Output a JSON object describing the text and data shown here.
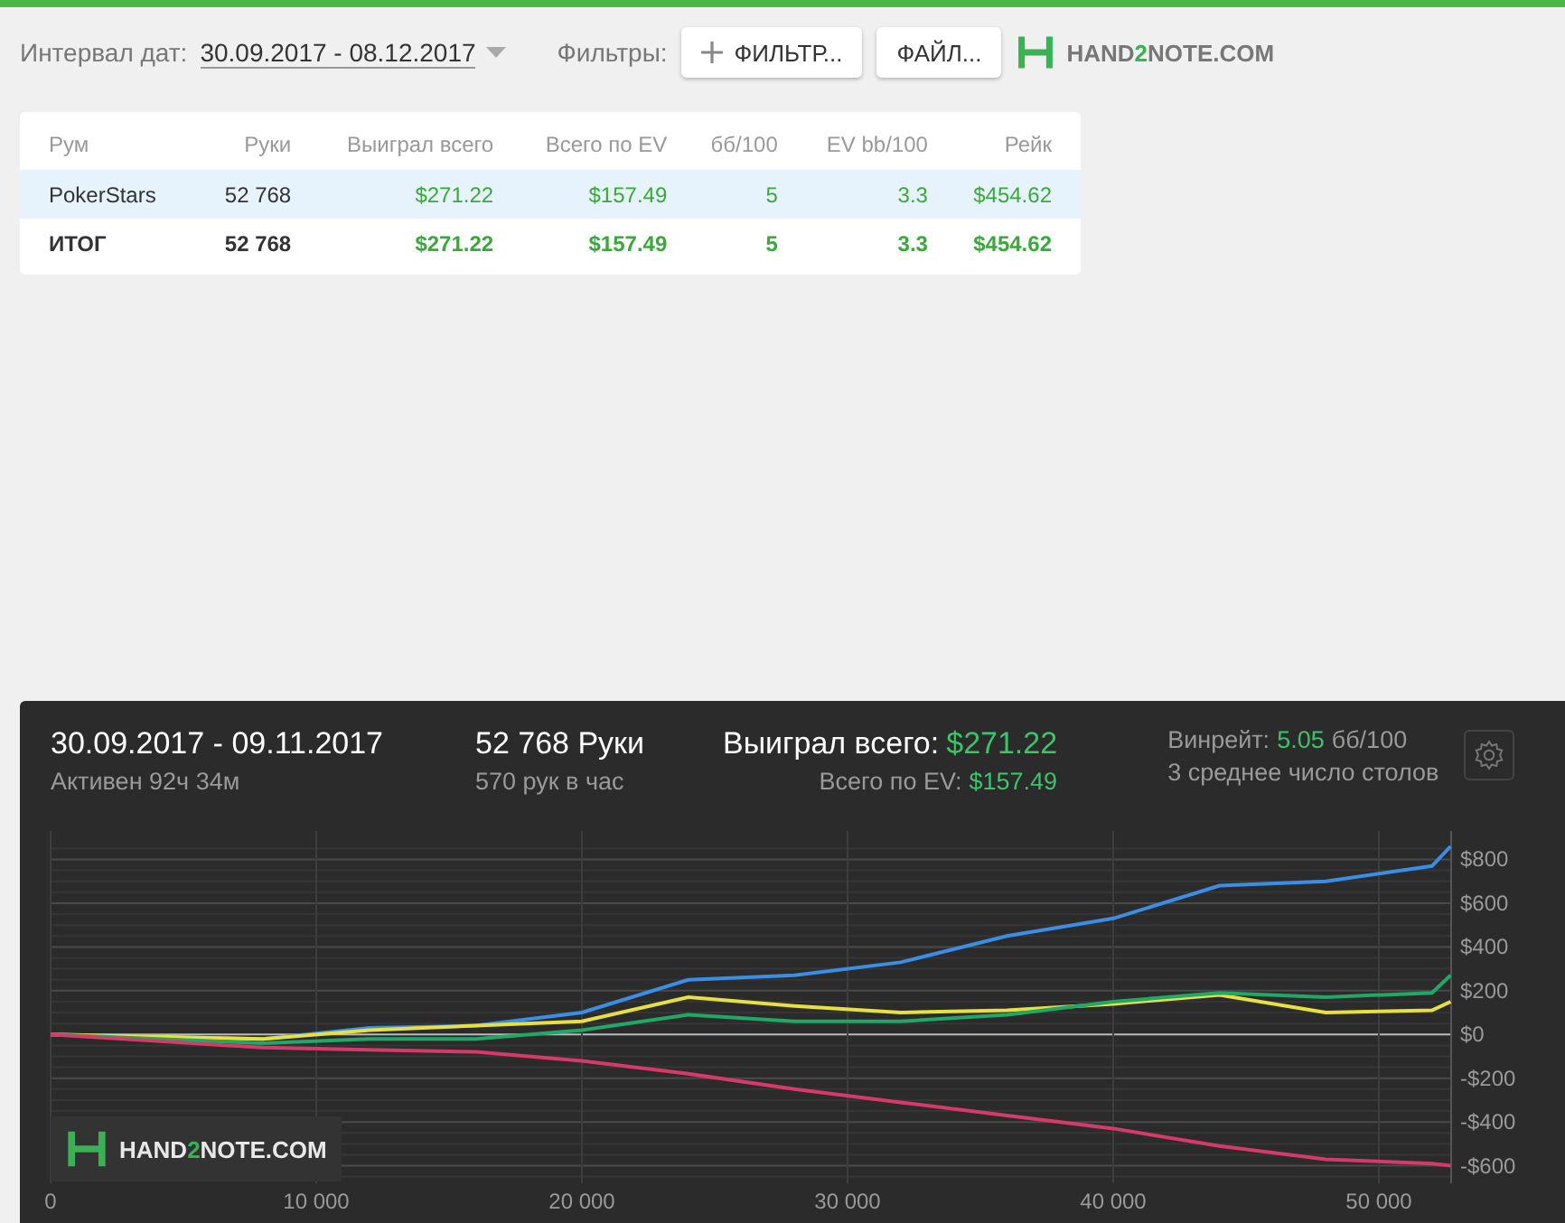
{
  "toolbar": {
    "date_label": "Интервал дат:",
    "date_range": "30.09.2017 - 08.12.2017",
    "filters_label": "Фильтры:",
    "buttons": [
      {
        "kind": "add",
        "label": "ФИЛЬТР..."
      },
      {
        "kind": "plain",
        "label": "ФАЙЛ..."
      }
    ],
    "logo": {
      "before": "HAND",
      "accent": "2",
      "after": "NOTE.COM"
    }
  },
  "table": {
    "columns": [
      "Рум",
      "Руки",
      "Выиграл всего",
      "Всего по EV",
      "бб/100",
      "EV bb/100",
      "Рейк"
    ],
    "rows": [
      {
        "kind": "room",
        "selected": true,
        "cells": [
          "PokerStars",
          "52 768",
          "$271.22",
          "$157.49",
          "5",
          "3.3",
          "$454.62"
        ]
      },
      {
        "kind": "total",
        "selected": false,
        "cells": [
          "ИТОГ",
          "52 768",
          "$271.22",
          "$157.49",
          "5",
          "3.3",
          "$454.62"
        ]
      }
    ]
  },
  "summary": {
    "period": "30.09.2017 - 09.11.2017",
    "active": "Активен 92ч 34м",
    "hands": "52 768 Руки",
    "hands_per_hour": "570 рук в час",
    "won_label": "Выиграл всего:",
    "won_value": "$271.22",
    "ev_label": "Всего по EV:",
    "ev_value": "$157.49",
    "winrate_label": "Винрейт:",
    "winrate_value": "5.05",
    "winrate_unit": "бб/100",
    "tables": "3 среднее число столов"
  },
  "chart": {
    "watermark": {
      "before": "HAND",
      "accent": "2",
      "after": "NOTE.COM"
    },
    "chart_data": {
      "type": "line",
      "xlim": [
        0,
        52720
      ],
      "ylim": [
        -680,
        930
      ],
      "grid": true,
      "x": [
        0,
        4000,
        8000,
        12000,
        16000,
        20000,
        24000,
        28000,
        32000,
        36000,
        40000,
        44000,
        48000,
        52000,
        52700
      ],
      "series": [
        {
          "color": "#3a8ee6",
          "values": [
            0,
            -10,
            -20,
            30,
            40,
            100,
            250,
            270,
            330,
            450,
            530,
            680,
            700,
            770,
            860
          ]
        },
        {
          "color": "#e8e03c",
          "values": [
            0,
            -10,
            -20,
            20,
            40,
            60,
            170,
            130,
            100,
            110,
            140,
            180,
            100,
            110,
            150
          ]
        },
        {
          "color": "#1fa866",
          "values": [
            0,
            -20,
            -40,
            -20,
            -20,
            20,
            90,
            60,
            60,
            90,
            150,
            190,
            170,
            190,
            270
          ]
        },
        {
          "color": "#d63a6a",
          "values": [
            0,
            -30,
            -60,
            -70,
            -80,
            -120,
            -180,
            -250,
            -310,
            -370,
            -430,
            -510,
            -570,
            -590,
            -600
          ]
        }
      ],
      "xticks": [
        {
          "value": 0,
          "label": "0"
        },
        {
          "value": 10000,
          "label": "10 000"
        },
        {
          "value": 20000,
          "label": "20 000"
        },
        {
          "value": 30000,
          "label": "30 000"
        },
        {
          "value": 40000,
          "label": "40 000"
        },
        {
          "value": 50000,
          "label": "50 000"
        }
      ],
      "yticks": [
        {
          "value": 800,
          "label": "$800"
        },
        {
          "value": 600,
          "label": "$600"
        },
        {
          "value": 400,
          "label": "$400"
        },
        {
          "value": 200,
          "label": "$200"
        },
        {
          "value": 0,
          "label": "$0"
        },
        {
          "value": -200,
          "label": "-$200"
        },
        {
          "value": -400,
          "label": "-$400"
        },
        {
          "value": -600,
          "label": "-$600"
        }
      ]
    }
  }
}
